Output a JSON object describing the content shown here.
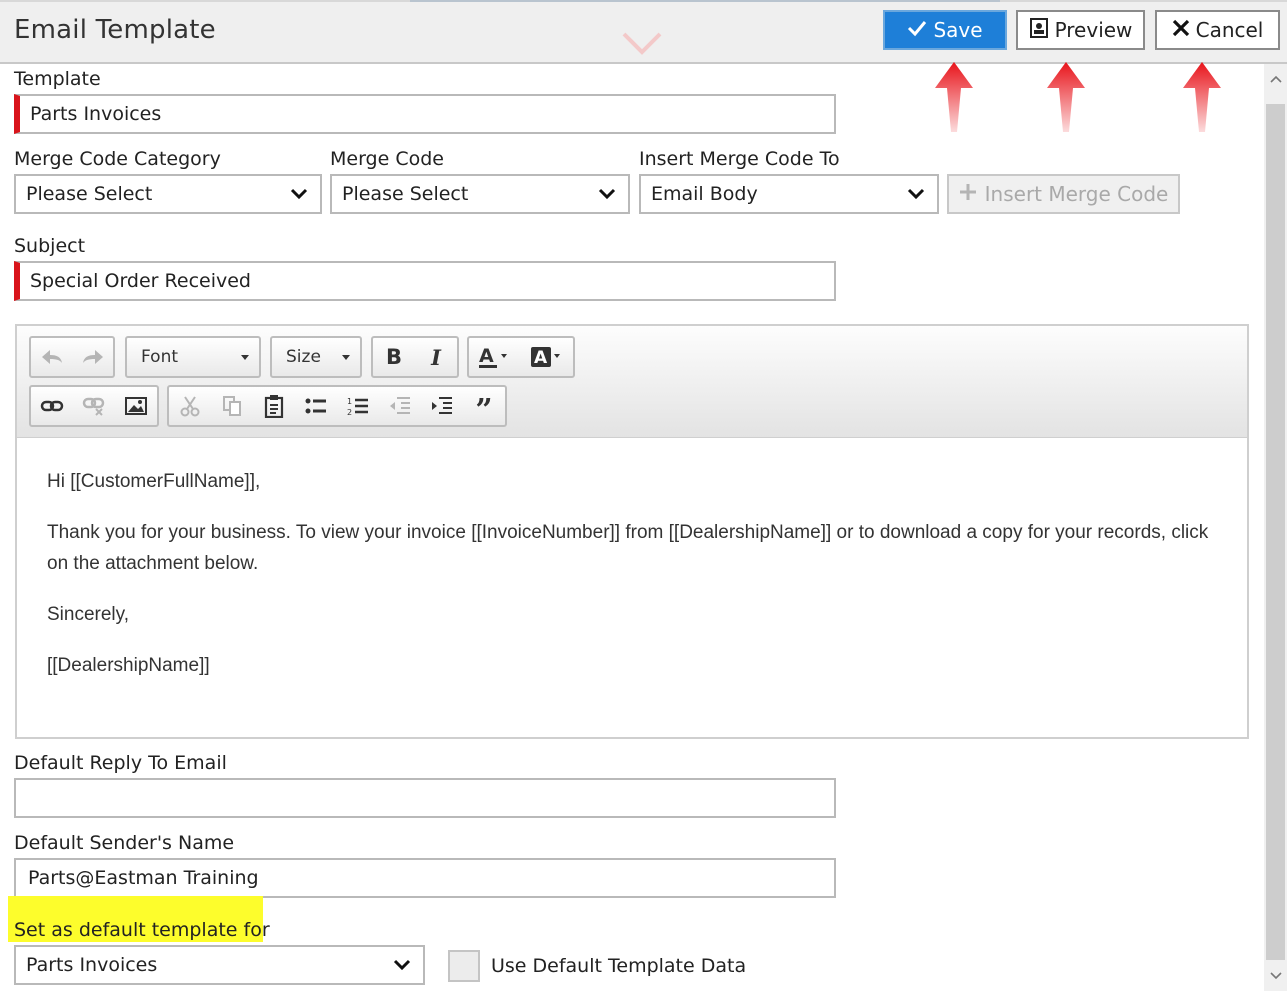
{
  "header": {
    "title": "Email Template",
    "save_label": "Save",
    "preview_label": "Preview",
    "cancel_label": "Cancel"
  },
  "template": {
    "label": "Template",
    "value": "Parts Invoices"
  },
  "merge_code_category": {
    "label": "Merge Code Category",
    "value": "Please Select"
  },
  "merge_code": {
    "label": "Merge Code",
    "value": "Please Select"
  },
  "insert_merge_code_to": {
    "label": "Insert Merge Code To",
    "value": "Email Body"
  },
  "insert_merge_code_button": "Insert Merge Code",
  "subject": {
    "label": "Subject",
    "value": "Special Order Received"
  },
  "editor": {
    "font_label": "Font",
    "size_label": "Size",
    "paragraphs": [
      "Hi [[CustomerFullName]],",
      "Thank you for your business. To view your invoice [[InvoiceNumber]] from [[DealershipName]] or to download a copy for your records, click on the attachment below.",
      "Sincerely,",
      "[[DealershipName]]"
    ]
  },
  "default_reply_to": {
    "label": "Default Reply To Email",
    "value": ""
  },
  "default_sender_name": {
    "label": "Default Sender's Name",
    "value": "Parts@Eastman Training"
  },
  "default_template_for": {
    "label": "Set as default template for",
    "value": "Parts Invoices"
  },
  "use_default_template_data": {
    "label": "Use Default Template Data",
    "checked": false
  },
  "colors": {
    "accent": "#1e7fd8",
    "required": "#d9141b",
    "annotation_arrow": "#e8141b",
    "highlight": "#fdfd2c"
  }
}
